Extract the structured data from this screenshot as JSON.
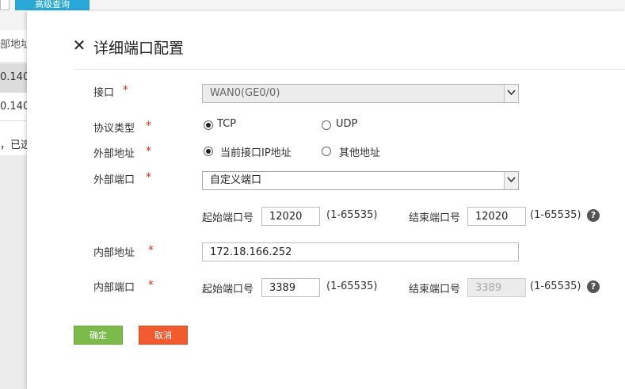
{
  "background": {
    "top_button_label": "高级查询",
    "column_header": "部地址",
    "rows": [
      "0.140",
      "0.140",
      "，已选"
    ]
  },
  "dialog": {
    "title": "详细端口配置",
    "required_mark": "*",
    "interface": {
      "label": "接口",
      "value": "WAN0(GE0/0)"
    },
    "protocol": {
      "label": "协议类型",
      "options": [
        "TCP",
        "UDP"
      ],
      "selected": "TCP"
    },
    "external_address": {
      "label": "外部地址",
      "options": [
        "当前接口IP地址",
        "其他地址"
      ],
      "selected": "当前接口IP地址"
    },
    "external_port": {
      "label": "外部端口",
      "value": "自定义端口",
      "start_label": "起始端口号",
      "start_value": "12020",
      "start_range": "(1-65535)",
      "end_label": "结束端口号",
      "end_value": "12020",
      "end_range": "(1-65535)"
    },
    "internal_address": {
      "label": "内部地址",
      "value": "172.18.166.252"
    },
    "internal_port": {
      "label": "内部端口",
      "start_label": "起始端口号",
      "start_value": "3389",
      "start_range": "(1-65535)",
      "end_label": "结束端口号",
      "end_value": "3389",
      "end_range": "(1-65535)"
    },
    "help_glyph": "?",
    "buttons": {
      "ok": "确定",
      "cancel": "取消"
    }
  },
  "colors": {
    "ok_button": "#7cba4c",
    "cancel_button": "#f25a2f",
    "required": "#e0301e",
    "top_button": "#29a8d8"
  }
}
